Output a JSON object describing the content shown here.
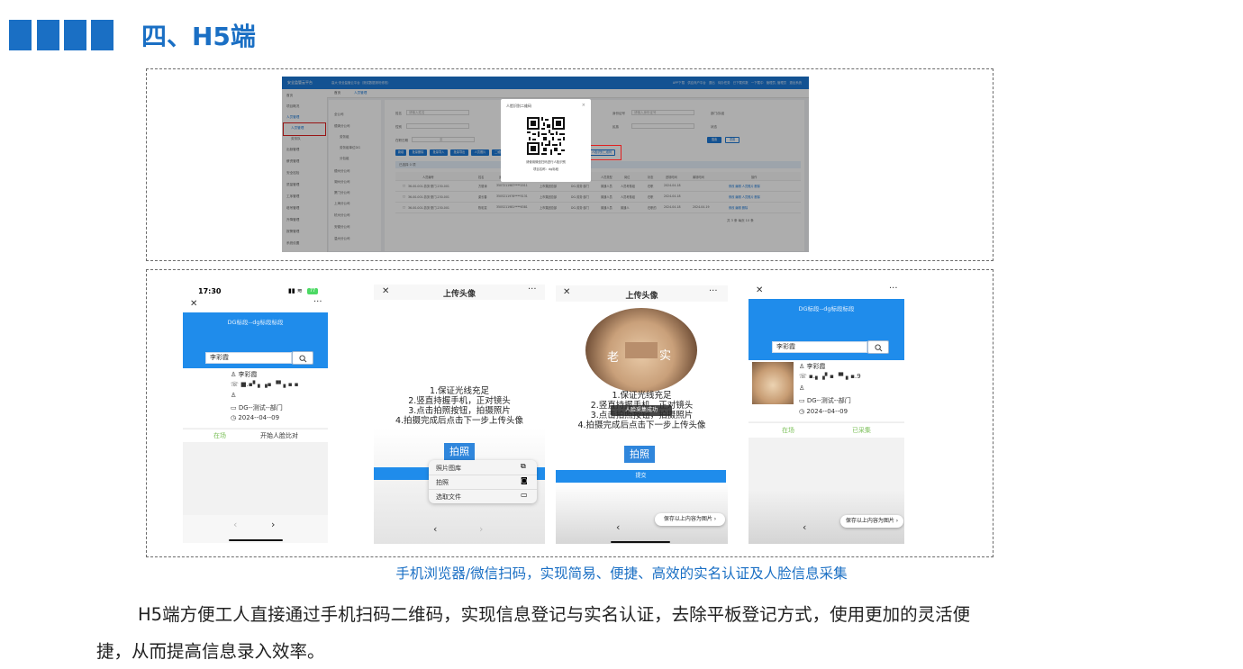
{
  "heading": {
    "title": "四、H5端",
    "accent_color": "#1a6fc4"
  },
  "desktop": {
    "app_name": "安全监管云平台",
    "breadcrumb": "高大·安全监管云平台（测试数据请勿修改）",
    "nav_items": [
      "APP下载",
      "供应商户平台",
      "退出",
      "待办任务",
      "已下载件数",
      "一下载中",
      "管理员, 管理员",
      "退出系统"
    ],
    "sidebar": [
      "首页",
      "项目概况",
      "人员管理",
      "人员管理",
      "劳务队",
      "出勤管理",
      "薪资管理",
      "安全巡检",
      "质量管理",
      "工序管理",
      "塔吊管理",
      "升降管理",
      "报警管理",
      "系统设置"
    ],
    "tabs": [
      "首页",
      "人员管理"
    ],
    "tree": [
      "全公司",
      "德清分公司",
      "劳务组",
      "劳务组单位DG",
      "分包组",
      "德州分公司",
      "湖州分公司",
      "厦门分公司",
      "上海分公司",
      "杭州分公司",
      "安徽分公司",
      "温州分公司"
    ],
    "filters": [
      "姓名",
      "请输入姓名",
      "身份证号",
      "请输入身份证号",
      "部门/队组",
      "性别",
      "民族",
      "状态",
      "在职日期",
      "至"
    ],
    "buttons": [
      "搜索",
      "重置",
      "新增",
      "批量删除",
      "批量导入",
      "批量导出",
      "人员照片",
      "二维码打印",
      "导出",
      "人脸识别二维码"
    ],
    "selected": "已选择 0 项",
    "table_headers": [
      "人员编号",
      "姓名",
      "身份证号",
      "所属部门",
      "部门队组",
      "人员类型",
      "岗位",
      "状态",
      "进场时间",
      "离场时间",
      "操作"
    ],
    "rows": [
      [
        "36-00-001-劳务·厦门-230-001",
        "方丽涛",
        "3507211987****2011",
        "上市集团总部",
        "DG-劳务·部门",
        "普通人员",
        "人员考核组",
        "在职",
        "2024-04-18",
        "",
        "修改 编辑 人员照片 删除"
      ],
      [
        "36-00-001-劳务·厦门-230-001",
        "梁长春",
        "3505211976****5131",
        "上市集团总部",
        "DG-劳务·部门",
        "普通人员",
        "人员考核组",
        "在职",
        "2024-04-18",
        "",
        "修改 编辑 人员照片 删除"
      ],
      [
        "36-00-001-劳务·厦门-230-001",
        "陈彩雯",
        "3505211981****6381",
        "上市集团总部",
        "DG-劳务·部门",
        "普通人员",
        "普通人",
        "在职的",
        "2024-04-18",
        "2024-04-19",
        "修改 编辑 删除"
      ]
    ],
    "pagination": "共 3 条 每页 10 条",
    "modal": {
      "title": "人脸识别二维码",
      "close": "×",
      "line1": "请使用微信扫码进行人脸识别",
      "line2": "项目名称：dg标段"
    }
  },
  "phone1": {
    "time": "17:30",
    "battery": "77",
    "title": "DG标段--dg标段标段",
    "search_value": "李彩霞",
    "name": "李彩霞",
    "phone": "■.▪▘▖▗▪ ▝▘▖▪ ▪",
    "dept": "DG--测试--部门",
    "date": "2024--04--09",
    "status": "在场",
    "action": "开始人脸比对"
  },
  "phone2": {
    "title": "上传头像",
    "instructions": [
      "1.保证光线充足",
      "2.竖直持握手机，正对镜头",
      "3.点击拍照按钮，拍摄照片",
      "4.拍摄完成后点击下一步上传头像"
    ],
    "shoot": "拍照",
    "menu": [
      "照片图库",
      "拍照",
      "选取文件"
    ]
  },
  "phone3": {
    "title": "上传头像",
    "photo_text": [
      "老",
      "实"
    ],
    "instructions": [
      "1.保证光线充足",
      "2.竖直持握手机，正对镜头",
      "3.点击拍照按钮，拍摄照片",
      "4.拍摄完成后点击下一步上传头像"
    ],
    "toast": "人脸采集成功",
    "shoot": "拍照",
    "submit": "提交",
    "save": "保存以上内容为图片"
  },
  "phone4": {
    "title": "DG标段--dg标段标段",
    "search_value": "李彩霞",
    "name": "李彩霞",
    "phone": "▪.▖▗▘▪ ▝▘▖▪.9",
    "dept": "DG--测试--部门",
    "date": "2024--04--09",
    "status": "在场",
    "collected": "已采集",
    "save": "保存以上内容为图片"
  },
  "caption": "手机浏览器/微信扫码，实现简易、便捷、高效的实名认证及人脸信息采集",
  "paragraph": {
    "line1": "H5端方便工人直接通过手机扫码二维码，实现信息登记与实名认证，去除平板登记方式，使用更加的灵活便",
    "line2": "捷，从而提高信息录入效率。"
  }
}
